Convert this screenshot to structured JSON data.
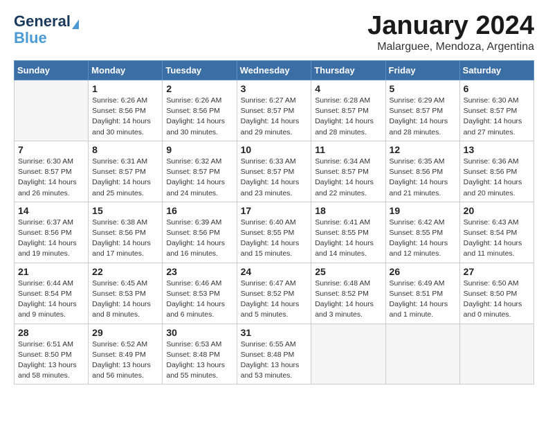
{
  "logo": {
    "general": "General",
    "blue": "Blue"
  },
  "header": {
    "title": "January 2024",
    "subtitle": "Malarguee, Mendoza, Argentina"
  },
  "days_of_week": [
    "Sunday",
    "Monday",
    "Tuesday",
    "Wednesday",
    "Thursday",
    "Friday",
    "Saturday"
  ],
  "weeks": [
    [
      {
        "num": "",
        "info": ""
      },
      {
        "num": "1",
        "info": "Sunrise: 6:26 AM\nSunset: 8:56 PM\nDaylight: 14 hours\nand 30 minutes."
      },
      {
        "num": "2",
        "info": "Sunrise: 6:26 AM\nSunset: 8:56 PM\nDaylight: 14 hours\nand 30 minutes."
      },
      {
        "num": "3",
        "info": "Sunrise: 6:27 AM\nSunset: 8:57 PM\nDaylight: 14 hours\nand 29 minutes."
      },
      {
        "num": "4",
        "info": "Sunrise: 6:28 AM\nSunset: 8:57 PM\nDaylight: 14 hours\nand 28 minutes."
      },
      {
        "num": "5",
        "info": "Sunrise: 6:29 AM\nSunset: 8:57 PM\nDaylight: 14 hours\nand 28 minutes."
      },
      {
        "num": "6",
        "info": "Sunrise: 6:30 AM\nSunset: 8:57 PM\nDaylight: 14 hours\nand 27 minutes."
      }
    ],
    [
      {
        "num": "7",
        "info": "Sunrise: 6:30 AM\nSunset: 8:57 PM\nDaylight: 14 hours\nand 26 minutes."
      },
      {
        "num": "8",
        "info": "Sunrise: 6:31 AM\nSunset: 8:57 PM\nDaylight: 14 hours\nand 25 minutes."
      },
      {
        "num": "9",
        "info": "Sunrise: 6:32 AM\nSunset: 8:57 PM\nDaylight: 14 hours\nand 24 minutes."
      },
      {
        "num": "10",
        "info": "Sunrise: 6:33 AM\nSunset: 8:57 PM\nDaylight: 14 hours\nand 23 minutes."
      },
      {
        "num": "11",
        "info": "Sunrise: 6:34 AM\nSunset: 8:57 PM\nDaylight: 14 hours\nand 22 minutes."
      },
      {
        "num": "12",
        "info": "Sunrise: 6:35 AM\nSunset: 8:56 PM\nDaylight: 14 hours\nand 21 minutes."
      },
      {
        "num": "13",
        "info": "Sunrise: 6:36 AM\nSunset: 8:56 PM\nDaylight: 14 hours\nand 20 minutes."
      }
    ],
    [
      {
        "num": "14",
        "info": "Sunrise: 6:37 AM\nSunset: 8:56 PM\nDaylight: 14 hours\nand 19 minutes."
      },
      {
        "num": "15",
        "info": "Sunrise: 6:38 AM\nSunset: 8:56 PM\nDaylight: 14 hours\nand 17 minutes."
      },
      {
        "num": "16",
        "info": "Sunrise: 6:39 AM\nSunset: 8:56 PM\nDaylight: 14 hours\nand 16 minutes."
      },
      {
        "num": "17",
        "info": "Sunrise: 6:40 AM\nSunset: 8:55 PM\nDaylight: 14 hours\nand 15 minutes."
      },
      {
        "num": "18",
        "info": "Sunrise: 6:41 AM\nSunset: 8:55 PM\nDaylight: 14 hours\nand 14 minutes."
      },
      {
        "num": "19",
        "info": "Sunrise: 6:42 AM\nSunset: 8:55 PM\nDaylight: 14 hours\nand 12 minutes."
      },
      {
        "num": "20",
        "info": "Sunrise: 6:43 AM\nSunset: 8:54 PM\nDaylight: 14 hours\nand 11 minutes."
      }
    ],
    [
      {
        "num": "21",
        "info": "Sunrise: 6:44 AM\nSunset: 8:54 PM\nDaylight: 14 hours\nand 9 minutes."
      },
      {
        "num": "22",
        "info": "Sunrise: 6:45 AM\nSunset: 8:53 PM\nDaylight: 14 hours\nand 8 minutes."
      },
      {
        "num": "23",
        "info": "Sunrise: 6:46 AM\nSunset: 8:53 PM\nDaylight: 14 hours\nand 6 minutes."
      },
      {
        "num": "24",
        "info": "Sunrise: 6:47 AM\nSunset: 8:52 PM\nDaylight: 14 hours\nand 5 minutes."
      },
      {
        "num": "25",
        "info": "Sunrise: 6:48 AM\nSunset: 8:52 PM\nDaylight: 14 hours\nand 3 minutes."
      },
      {
        "num": "26",
        "info": "Sunrise: 6:49 AM\nSunset: 8:51 PM\nDaylight: 14 hours\nand 1 minute."
      },
      {
        "num": "27",
        "info": "Sunrise: 6:50 AM\nSunset: 8:50 PM\nDaylight: 14 hours\nand 0 minutes."
      }
    ],
    [
      {
        "num": "28",
        "info": "Sunrise: 6:51 AM\nSunset: 8:50 PM\nDaylight: 13 hours\nand 58 minutes."
      },
      {
        "num": "29",
        "info": "Sunrise: 6:52 AM\nSunset: 8:49 PM\nDaylight: 13 hours\nand 56 minutes."
      },
      {
        "num": "30",
        "info": "Sunrise: 6:53 AM\nSunset: 8:48 PM\nDaylight: 13 hours\nand 55 minutes."
      },
      {
        "num": "31",
        "info": "Sunrise: 6:55 AM\nSunset: 8:48 PM\nDaylight: 13 hours\nand 53 minutes."
      },
      {
        "num": "",
        "info": ""
      },
      {
        "num": "",
        "info": ""
      },
      {
        "num": "",
        "info": ""
      }
    ]
  ]
}
